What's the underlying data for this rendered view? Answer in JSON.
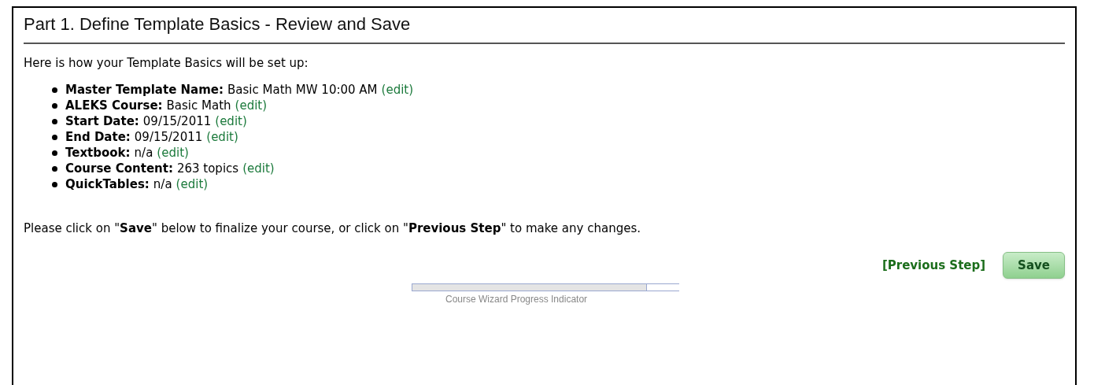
{
  "title": "Part 1. Define Template Basics - Review and Save",
  "intro": "Here is how your Template Basics will be set up:",
  "items": [
    {
      "label": "Master Template Name:",
      "value": "Basic Math MW 10:00 AM",
      "link": "(edit)"
    },
    {
      "label": "ALEKS Course:",
      "value": "Basic Math",
      "link": "(edit)"
    },
    {
      "label": "Start Date:",
      "value": "09/15/2011",
      "link": "(edit)"
    },
    {
      "label": "End Date:",
      "value": "09/15/2011",
      "link": "(edit)"
    },
    {
      "label": "Textbook:",
      "value": "n/a",
      "link": "(edit)"
    },
    {
      "label": "Course Content:",
      "value": "263 topics",
      "link": "(edit)"
    },
    {
      "label": "QuickTables:",
      "value": "n/a",
      "link": "(edit)"
    }
  ],
  "instruction": "Please click on \"**Save**\" below to finalize your course, or click on \"**Previous Step**\" to make any changes.",
  "previous_link": "[Previous Step]",
  "save_button": "Save",
  "progress": {
    "level": 0.88,
    "caption": "Course Wizard Progress Indicator"
  }
}
